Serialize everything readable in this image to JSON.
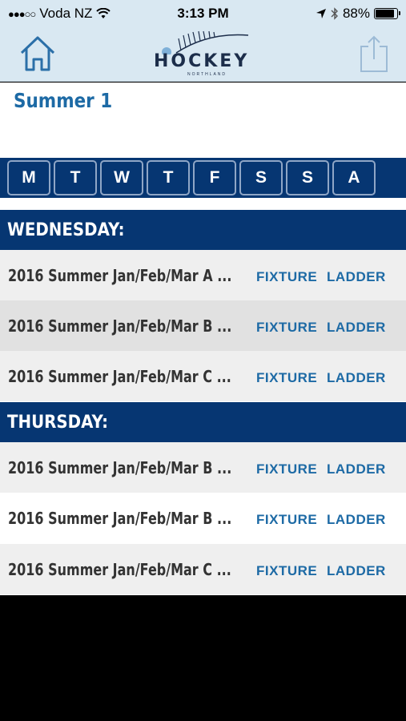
{
  "status_bar": {
    "carrier": "Voda NZ",
    "time": "3:13 PM",
    "battery": "88%",
    "battery_level": 0.88,
    "signal_icon": "signal-dots-icon",
    "wifi_icon": "wifi-icon",
    "location_icon": "location-arrow-icon",
    "bluetooth_icon": "bluetooth-icon"
  },
  "nav": {
    "logo_text": "HOCKEY",
    "logo_subtext": "NORTHLAND",
    "home_icon": "home-icon",
    "share_icon": "share-icon"
  },
  "page": {
    "title": "Summer 1"
  },
  "days": [
    "M",
    "T",
    "W",
    "T",
    "F",
    "S",
    "S",
    "A"
  ],
  "sections": [
    {
      "header": "WEDNESDAY:",
      "rows": [
        {
          "name": "2016 Summer Jan/Feb/Mar A ...",
          "fixture": "FIXTURE",
          "ladder": "LADDER"
        },
        {
          "name": "2016 Summer Jan/Feb/Mar B ...",
          "fixture": "FIXTURE",
          "ladder": "LADDER"
        },
        {
          "name": "2016 Summer Jan/Feb/Mar C ...",
          "fixture": "FIXTURE",
          "ladder": "LADDER"
        }
      ]
    },
    {
      "header": "THURSDAY:",
      "rows": [
        {
          "name": "2016 Summer Jan/Feb/Mar B ...",
          "fixture": "FIXTURE",
          "ladder": "LADDER"
        },
        {
          "name": "2016 Summer Jan/Feb/Mar B ...",
          "fixture": "FIXTURE",
          "ladder": "LADDER"
        },
        {
          "name": "2016 Summer Jan/Feb/Mar C ...",
          "fixture": "FIXTURE",
          "ladder": "LADDER"
        }
      ]
    }
  ],
  "colors": {
    "brand_navy": "#063672",
    "link_blue": "#1d6aa5",
    "nav_background": "#d9e8f2"
  }
}
